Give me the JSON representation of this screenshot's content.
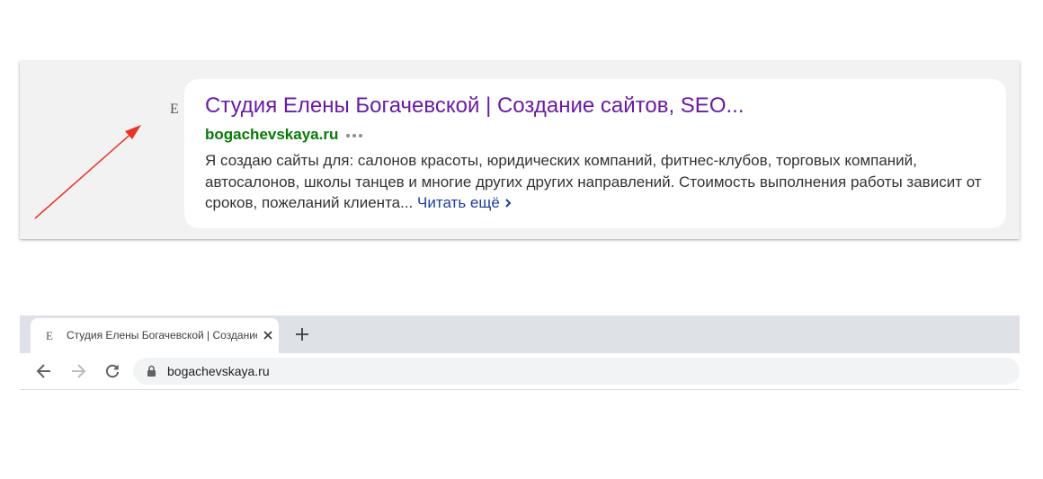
{
  "serp": {
    "favicon_letter": "E",
    "title": "Студия Елены Богачевской | Создание сайтов, SEO...",
    "url": "bogachevskaya.ru",
    "snippet": "Я создаю сайты для: салонов красоты, юридических компаний, фитнес-клубов, торговых компаний, автосалонов, школы танцев и многие других других направлений. Стоимость выполнения работы зависит от сроков, пожеланий клиента...",
    "read_more": "Читать ещё",
    "colors": {
      "title": "#6a1ba6",
      "url": "#077a07",
      "read_more": "#1e3f9a",
      "annotation_arrow": "#e8352c"
    }
  },
  "browser": {
    "tab": {
      "favicon_letter": "E",
      "title": "Студия Елены Богачевской | Создание сайтов, SEO..."
    },
    "address": "bogachevskaya.ru",
    "icons": [
      "close-icon",
      "plus-icon",
      "back-icon",
      "forward-icon",
      "reload-icon",
      "lock-icon"
    ]
  }
}
